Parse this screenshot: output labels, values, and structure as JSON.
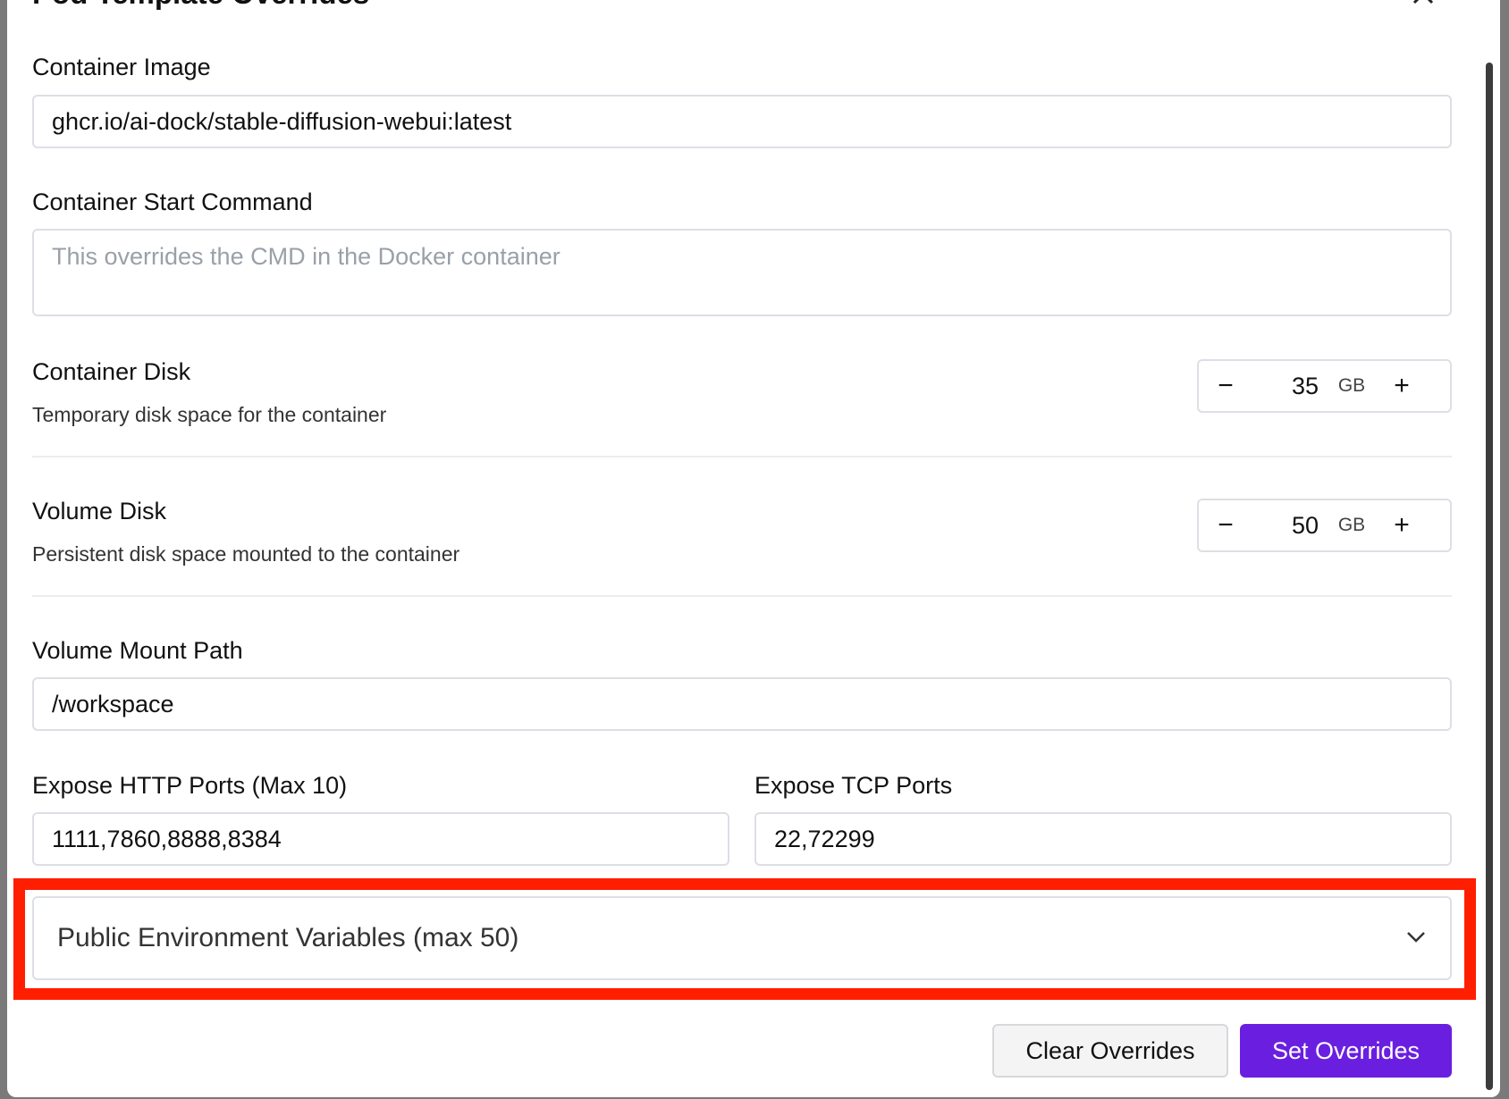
{
  "dialog": {
    "title": "Pod Template Overrides"
  },
  "container_image": {
    "label": "Container Image",
    "value": "ghcr.io/ai-dock/stable-diffusion-webui:latest"
  },
  "start_command": {
    "label": "Container Start Command",
    "placeholder": "This overrides the CMD in the Docker container"
  },
  "container_disk": {
    "label": "Container Disk",
    "description": "Temporary disk space for the container",
    "value": "35",
    "unit": "GB"
  },
  "volume_disk": {
    "label": "Volume Disk",
    "description": "Persistent disk space mounted to the container",
    "value": "50",
    "unit": "GB"
  },
  "volume_mount": {
    "label": "Volume Mount Path",
    "value": "/workspace"
  },
  "http_ports": {
    "label": "Expose HTTP Ports (Max 10)",
    "value": "1111,7860,8888,8384"
  },
  "tcp_ports": {
    "label": "Expose TCP Ports",
    "value": "22,72299"
  },
  "env_vars": {
    "label": "Public Environment Variables (max 50)",
    "expanded": false
  },
  "actions": {
    "clear_label": "Clear Overrides",
    "set_label": "Set Overrides"
  },
  "colors": {
    "primary": "#6a1fe0",
    "highlight": "#ff1e00"
  },
  "icons": {
    "close": "close-icon",
    "minus": "minus-icon",
    "plus": "plus-icon",
    "chevron": "chevron-down-icon"
  }
}
